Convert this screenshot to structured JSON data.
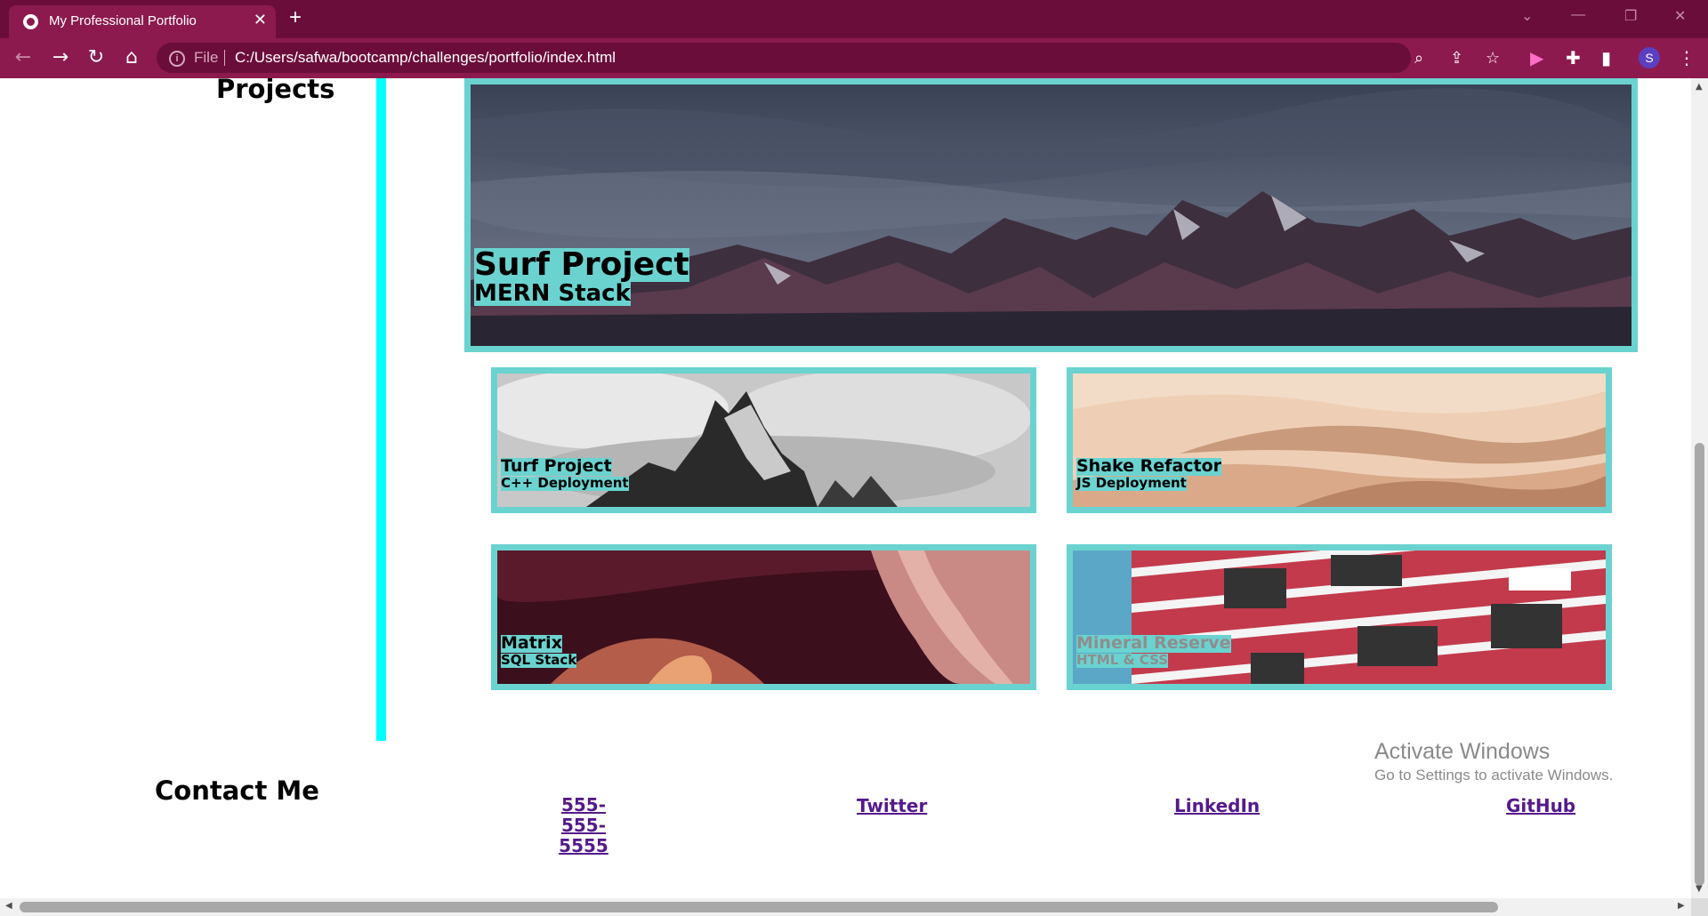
{
  "browser": {
    "tab_title": "My Professional Portfolio",
    "tab_close": "✕",
    "new_tab": "+",
    "file_label": "File",
    "url": "C:/Users/safwa/bootcamp/challenges/portfolio/index.html",
    "profile_initial": "S",
    "colors": {
      "frame": "#6b0d3a",
      "toolbar": "#8c1a4e"
    }
  },
  "page": {
    "projects_heading": "Projects",
    "accent_color": "#6ad3d0",
    "rule_color": "#00ffff",
    "projects": [
      {
        "title": "Surf Project",
        "subtitle": "MERN Stack",
        "image": "mountain-range-dusk"
      },
      {
        "title": "Turf Project",
        "subtitle": "C++ Deployment",
        "image": "snowy-peak-bw"
      },
      {
        "title": "Shake Refactor",
        "subtitle": "JS Deployment",
        "image": "desert-dunes"
      },
      {
        "title": "Matrix",
        "subtitle": "SQL Stack",
        "image": "canyon-rock"
      },
      {
        "title": "Mineral Reserve",
        "subtitle": "HTML & CSS",
        "image": "red-building"
      }
    ],
    "contact_heading": "Contact Me",
    "contact": {
      "phone": [
        "555-",
        "555-",
        "5555"
      ],
      "twitter": "Twitter",
      "linkedin": "LinkedIn",
      "github": "GitHub"
    }
  },
  "watermark": {
    "title": "Activate Windows",
    "subtitle": "Go to Settings to activate Windows."
  }
}
